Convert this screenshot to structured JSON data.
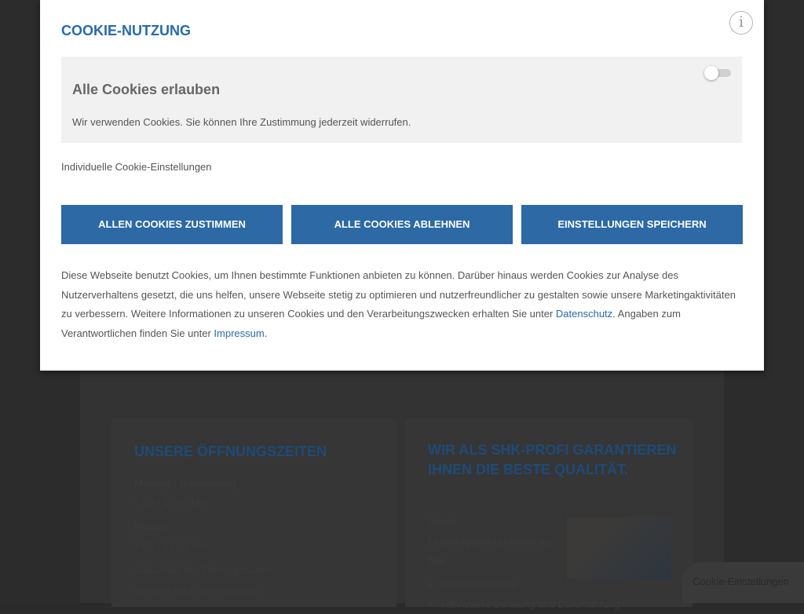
{
  "background": {
    "opening_hours": {
      "title": "Unsere Öffnungszeiten",
      "row1_label": "Montag - Donnerstag",
      "row1_time": "7:00 - 16:00 Uhr",
      "row2_label": "Freitag",
      "row2_time": "7:00 - 13:30 Uhr",
      "outside_line1": "Außerhalb der Öffnungszeiten:",
      "outside_line2": "Termine nach Vereinbarung."
    },
    "quality": {
      "title": "Wir als SHK-Profi garantieren Ihnen die beste Qualität.",
      "promise": "Unser Leistungsversprechen an Sie.",
      "list": [
        "Fachkompetente",
        "individuelle Beratung und Durchführung"
      ]
    },
    "cookie_settings_button": "Cookie-Einstellungen"
  },
  "modal": {
    "title": "COOKIE-NUTZUNG",
    "info_icon": "i",
    "allow_all": {
      "title": "Alle Cookies erlauben",
      "text": "Wir verwenden Cookies. Sie können Ihre Zustimmung jederzeit widerrufen.",
      "toggle_on": false
    },
    "individual_settings": "Individuelle Cookie-Einstellungen",
    "buttons": {
      "accept": "Allen Cookies zustimmen",
      "reject": "Alle Cookies ablehnen",
      "save": "Einstellungen speichern"
    },
    "info": {
      "part1": "Diese Webseite benutzt Cookies, um Ihnen bestimmte Funktionen anbieten zu können. Darüber hinaus werden Cookies zur Analyse des Nutzerverhaltens gesetzt, die uns helfen, unsere Webseite stetig zu optimieren und nutzerfreundlicher zu gestalten sowie unsere Marketingaktivitäten zu verbessern. Weitere Informationen zu unseren Cookies und den Verarbeitungszwecken erhalten Sie unter ",
      "privacy_link": "Datenschutz",
      "part2": ". Angaben zum Verantwortlichen finden Sie unter ",
      "imprint_link": "Impressum",
      "part3": "."
    }
  },
  "colors": {
    "accent": "#2c69a5",
    "title": "#2a6aa6",
    "overlay": "#2c2c2c"
  }
}
